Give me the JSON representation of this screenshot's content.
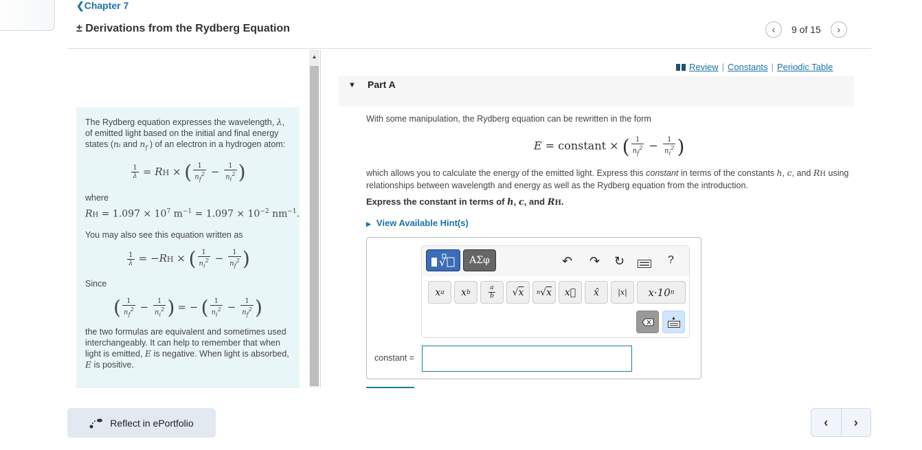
{
  "header": {
    "chapter_link": "Chapter 7",
    "title": "± Derivations from the Rydberg Equation",
    "pager": {
      "current": 9,
      "total": 15,
      "text": "9 of 15",
      "prev_icon": "chevron-left-icon",
      "next_icon": "chevron-right-icon"
    }
  },
  "intro": {
    "p1": "The Rydberg equation expresses the wavelength, λ, of emitted light based on the initial and final energy states (nᵢ and n_f ) of an electron in a hydrogen atom:",
    "p1_parts": [
      "The Rydberg equation expresses the wavelength, ",
      "λ",
      ", of emitted light based on the initial and final energy states (",
      "nᵢ",
      " and ",
      "n_f",
      " ) of an electron in a hydrogen atom:"
    ],
    "eq1": "1/λ = R_H × (1/n_f² − 1/n_i²)",
    "where_label": "where",
    "rh_value": "R_H = 1.097 × 10⁷ m⁻¹ = 1.097 × 10⁻² nm⁻¹.",
    "p2": "You may also see this equation written as",
    "eq2": "1/λ = −R_H × (1/n_i² − 1/n_f²)",
    "since_label": "Since",
    "eq3": "(1/n_f² − 1/n_i²) = −(1/n_i² − 1/n_f²)",
    "p3_parts": [
      "the two formulas are equivalent and sometimes used interchangeably. It can help to remember that when light is emitted, ",
      "E",
      " is negative. When light is absorbed, ",
      "E",
      " is positive."
    ]
  },
  "resources": {
    "review": "Review",
    "constants": "Constants",
    "periodic_table": "Periodic Table",
    "separator": "|",
    "icon": "book-icon"
  },
  "part": {
    "label": "Part A",
    "caret_icon": "caret-down-icon",
    "intro_text": "With some manipulation, the Rydberg equation can be rewritten in the form",
    "equation": "E = constant × (1/n_f² − 1/n_i²)",
    "text_parts": [
      "which allows you to calculate the energy of the emitted light. Express this ",
      "constant",
      " in terms of the constants ",
      "h",
      ", ",
      "c",
      ", and ",
      "R_H",
      " using relationships between wavelength and energy as well as the Rydberg equation from the introduction."
    ],
    "instruction_parts": [
      "Express the constant in terms of ",
      "h",
      ", ",
      "c",
      ", and ",
      "R_H",
      "."
    ],
    "hint_link": "View Available Hint(s)"
  },
  "toolbar": {
    "templates_label": "templates",
    "greek_label": "ΑΣφ",
    "icons": [
      "undo-icon",
      "redo-icon",
      "reset-icon",
      "keyboard-icon",
      "help-icon"
    ],
    "help_label": "?",
    "keys": [
      {
        "name": "superscript",
        "label": "xᵃ"
      },
      {
        "name": "subscript",
        "label": "x_b"
      },
      {
        "name": "fraction",
        "label": "a/b"
      },
      {
        "name": "square-root",
        "label": "√x"
      },
      {
        "name": "nth-root",
        "label": "ⁿ√x"
      },
      {
        "name": "vector",
        "label": "x⃗"
      },
      {
        "name": "unit-vector",
        "label": "x̂"
      },
      {
        "name": "absolute-value",
        "label": "|x|"
      },
      {
        "name": "scientific-notation",
        "label": "x·10ⁿ"
      }
    ]
  },
  "answer": {
    "label": "constant =",
    "value": ""
  },
  "footer": {
    "reflect_button": "Reflect in ePortfolio",
    "prev_icon": "chevron-left-icon",
    "next_icon": "chevron-right-icon"
  }
}
